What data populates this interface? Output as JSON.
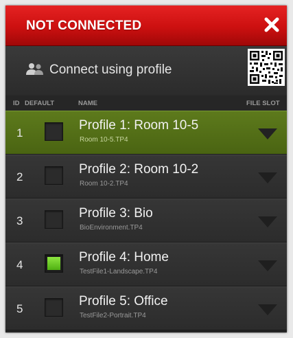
{
  "window": {
    "title": "NOT CONNECTED",
    "close_icon": "close-icon"
  },
  "connect": {
    "label": "Connect using profile",
    "icon": "users-icon",
    "qr_icon": "qr-code-icon"
  },
  "columns": {
    "id": "ID",
    "default": "DEFAULT",
    "name": "NAME",
    "file_slot": "FILE SLOT"
  },
  "colors": {
    "title_red": "#d41515",
    "active_row_green": "#55701a",
    "checkbox_green": "#6fcf22"
  },
  "profiles": [
    {
      "id": "1",
      "name": "Profile 1: Room 10-5",
      "file": "Room 10-5.TP4",
      "default": false,
      "active": true
    },
    {
      "id": "2",
      "name": "Profile 2: Room 10-2",
      "file": "Room 10-2.TP4",
      "default": false,
      "active": false
    },
    {
      "id": "3",
      "name": "Profile 3: Bio",
      "file": "BioEnvironment.TP4",
      "default": false,
      "active": false
    },
    {
      "id": "4",
      "name": "Profile 4: Home",
      "file": "TestFile1-Landscape.TP4",
      "default": true,
      "active": false
    },
    {
      "id": "5",
      "name": "Profile 5: Office",
      "file": "TestFile2-Portrait.TP4",
      "default": false,
      "active": false
    }
  ]
}
